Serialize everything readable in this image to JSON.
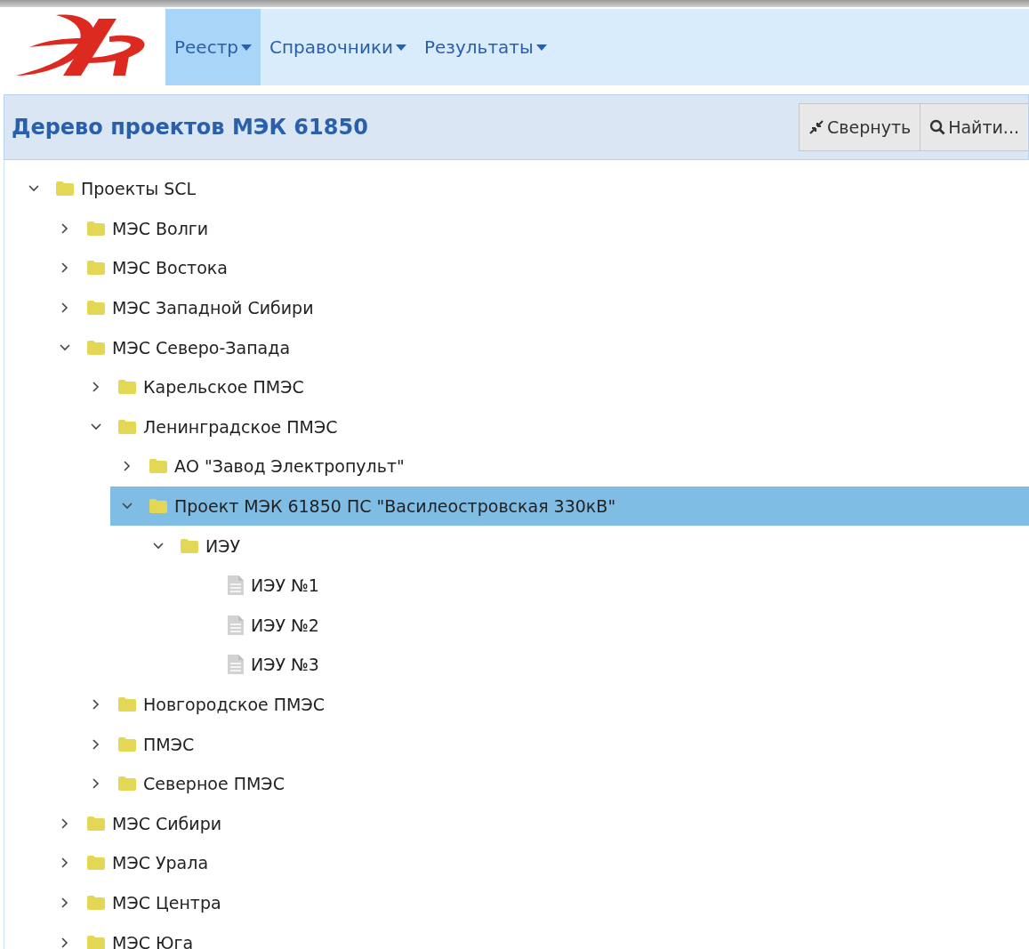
{
  "menu": [
    {
      "label": "Реестр",
      "selected": true
    },
    {
      "label": "Справочники",
      "selected": false
    },
    {
      "label": "Результаты",
      "selected": false
    }
  ],
  "panel": {
    "title": "Дерево проектов МЭК 61850",
    "buttons": [
      {
        "label": "Свернуть",
        "kind": "collapse"
      },
      {
        "label": "Найти...",
        "kind": "search"
      }
    ]
  },
  "tree": [
    {
      "label": "Проекты SCL",
      "kind": "folder",
      "expanded": true,
      "selected": false,
      "children": [
        {
          "label": "МЭС Волги",
          "kind": "folder",
          "expanded": false,
          "selected": false
        },
        {
          "label": "МЭС Востока",
          "kind": "folder",
          "expanded": false,
          "selected": false
        },
        {
          "label": "МЭС Западной Сибири",
          "kind": "folder",
          "expanded": false,
          "selected": false
        },
        {
          "label": "МЭС Северо-Запада",
          "kind": "folder",
          "expanded": true,
          "selected": false,
          "children": [
            {
              "label": "Карельское ПМЭС",
              "kind": "folder",
              "expanded": false,
              "selected": false
            },
            {
              "label": "Ленинградское ПМЭС",
              "kind": "folder",
              "expanded": true,
              "selected": false,
              "children": [
                {
                  "label": "АО \"Завод Электропульт\"",
                  "kind": "folder",
                  "expanded": false,
                  "selected": false
                },
                {
                  "label": "Проект МЭК 61850 ПС \"Василеостровская 330кВ\"",
                  "kind": "folder",
                  "expanded": true,
                  "selected": true,
                  "children": [
                    {
                      "label": "ИЭУ",
                      "kind": "folder",
                      "expanded": true,
                      "selected": false,
                      "children": [
                        {
                          "label": "ИЭУ №1",
                          "kind": "file",
                          "selected": false
                        },
                        {
                          "label": "ИЭУ №2",
                          "kind": "file",
                          "selected": false
                        },
                        {
                          "label": "ИЭУ №3",
                          "kind": "file",
                          "selected": false
                        }
                      ]
                    }
                  ]
                }
              ]
            },
            {
              "label": "Новгородское ПМЭС",
              "kind": "folder",
              "expanded": false,
              "selected": false
            },
            {
              "label": "ПМЭС",
              "kind": "folder",
              "expanded": false,
              "selected": false
            },
            {
              "label": "Северное ПМЭС",
              "kind": "folder",
              "expanded": false,
              "selected": false
            }
          ]
        },
        {
          "label": "МЭС Сибири",
          "kind": "folder",
          "expanded": false,
          "selected": false
        },
        {
          "label": "МЭС Урала",
          "kind": "folder",
          "expanded": false,
          "selected": false
        },
        {
          "label": "МЭС Центра",
          "kind": "folder",
          "expanded": false,
          "selected": false
        },
        {
          "label": "МЭС Юга",
          "kind": "folder",
          "expanded": false,
          "selected": false
        }
      ]
    }
  ]
}
